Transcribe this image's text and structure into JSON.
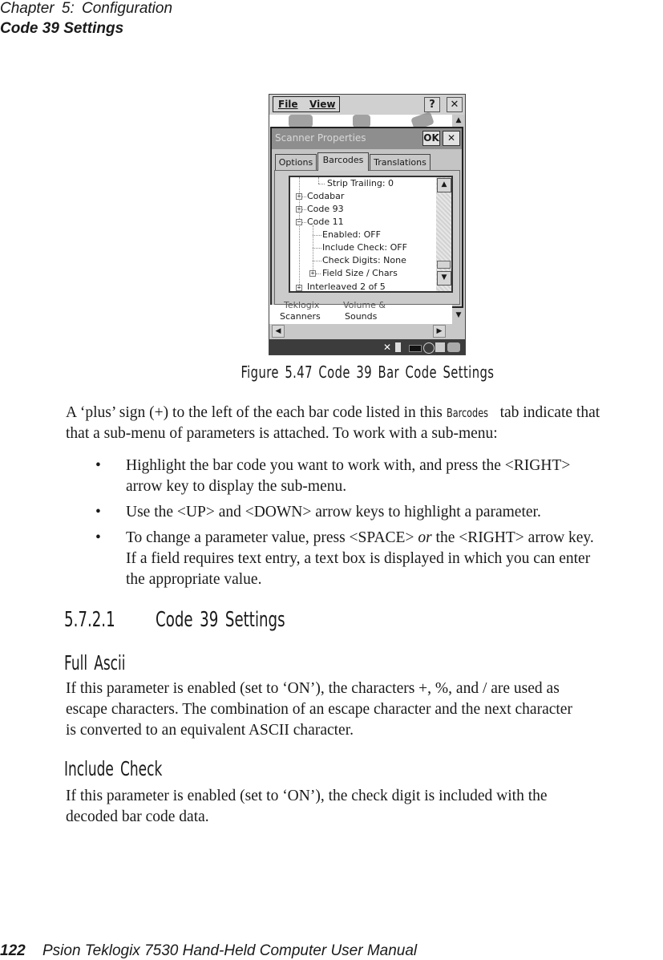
{
  "header": {
    "chapter": "Chapter  5:  Configuration",
    "section": "Code 39 Settings"
  },
  "device": {
    "menu": {
      "file": "File",
      "view": "View",
      "help": "?",
      "close": "✕"
    },
    "dialog": {
      "title": "Scanner Properties",
      "ok": "OK",
      "close": "✕",
      "tabs": [
        "Options",
        "Barcodes",
        "Translations"
      ],
      "active_tab": "Barcodes",
      "tree": [
        {
          "label": "Strip Trailing: 0",
          "expander": ""
        },
        {
          "label": "Codabar",
          "expander": "+"
        },
        {
          "label": "Code 93",
          "expander": "+"
        },
        {
          "label": "Code 11",
          "expander": "−"
        },
        {
          "label": "Enabled: OFF",
          "expander": ""
        },
        {
          "label": "Include Check: OFF",
          "expander": ""
        },
        {
          "label": "Check Digits: None",
          "expander": ""
        },
        {
          "label": "Field Size / Chars",
          "expander": "+"
        },
        {
          "label": "Interleaved 2 of 5",
          "expander": "+"
        }
      ]
    },
    "desktop_labels": {
      "item1_line1": "Teklogix",
      "item1_line2": "Scanners",
      "item2_line1": "Volume &",
      "item2_line2": "Sounds"
    },
    "tray_icons": [
      "network-x-icon",
      "connection-icon",
      "battery-icon",
      "no-signal-icon",
      "camera-icon",
      "dock-icon"
    ]
  },
  "figure_caption": "Figure 5.47  Code 39  Bar Code Settings",
  "intro": {
    "before": "A ‘plus’ sign (+) to the left of the each bar code listed in this ",
    "tab_ref": "Barcodes",
    "after": " tab indicate that",
    "line2": "that a sub-menu of parameters is attached. To work with a sub-menu:"
  },
  "bullets": [
    {
      "line1": "Highlight the bar code you want to work with, and press the <RIGHT>",
      "line2": "arrow key to display the sub-menu."
    },
    {
      "line1": "Use the <UP> and <DOWN> arrow keys to highlight a parameter."
    },
    {
      "line1a": "To change a parameter value, press <SPACE> ",
      "line1_em": "or",
      "line1b": " the <RIGHT> arrow key.",
      "line2": "If a field requires text entry, a text box is displayed in which you can enter",
      "line3": "the appropriate value."
    }
  ],
  "bullet_char": "•",
  "section": {
    "number": "5.7.2.1",
    "title": "Code 39 Settings"
  },
  "full_ascii": {
    "heading": "Full Ascii",
    "lines": [
      "If this parameter is enabled (set to ‘ON’), the characters +, %, and / are used as",
      "escape characters. The combination of an escape character and the next character",
      "is converted to an equivalent ASCII character."
    ]
  },
  "include_check": {
    "heading": "Include Check",
    "lines": [
      "If this parameter is enabled (set to ‘ON’), the check digit is included with the",
      "decoded bar code data."
    ]
  },
  "footer": {
    "page": "122",
    "title": "Psion Teklogix 7530 Hand-Held Computer User Manual"
  }
}
